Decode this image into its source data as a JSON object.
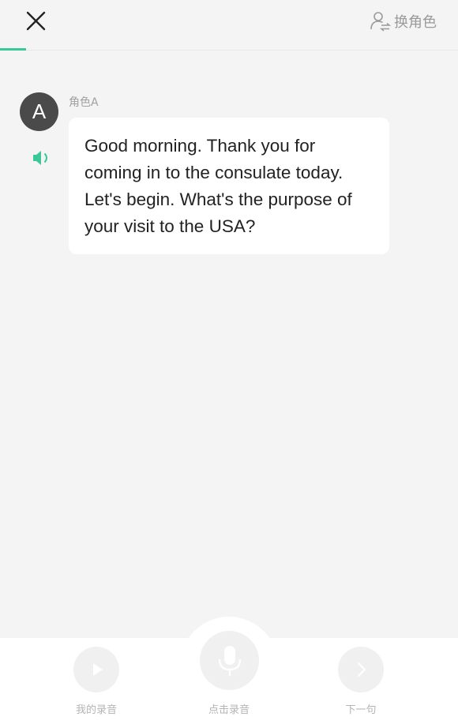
{
  "header": {
    "close_icon": "close-icon",
    "switch_role_label": "换角色",
    "switch_role_icon": "person-switch-icon",
    "accent_color": "#3cc79b"
  },
  "dialogue": {
    "avatar_letter": "A",
    "role_name": "角色A",
    "speaker_icon": "speaker-icon",
    "message": "Good morning. Thank you for coming in to the consulate today. Let's begin. What's the purpose of your visit to the USA?"
  },
  "controls": {
    "my_recording_label": "我的录音",
    "record_label": "点击录音",
    "next_label": "下一句",
    "play_icon": "play-icon",
    "mic_icon": "microphone-icon",
    "next_icon": "chevron-right-icon"
  }
}
